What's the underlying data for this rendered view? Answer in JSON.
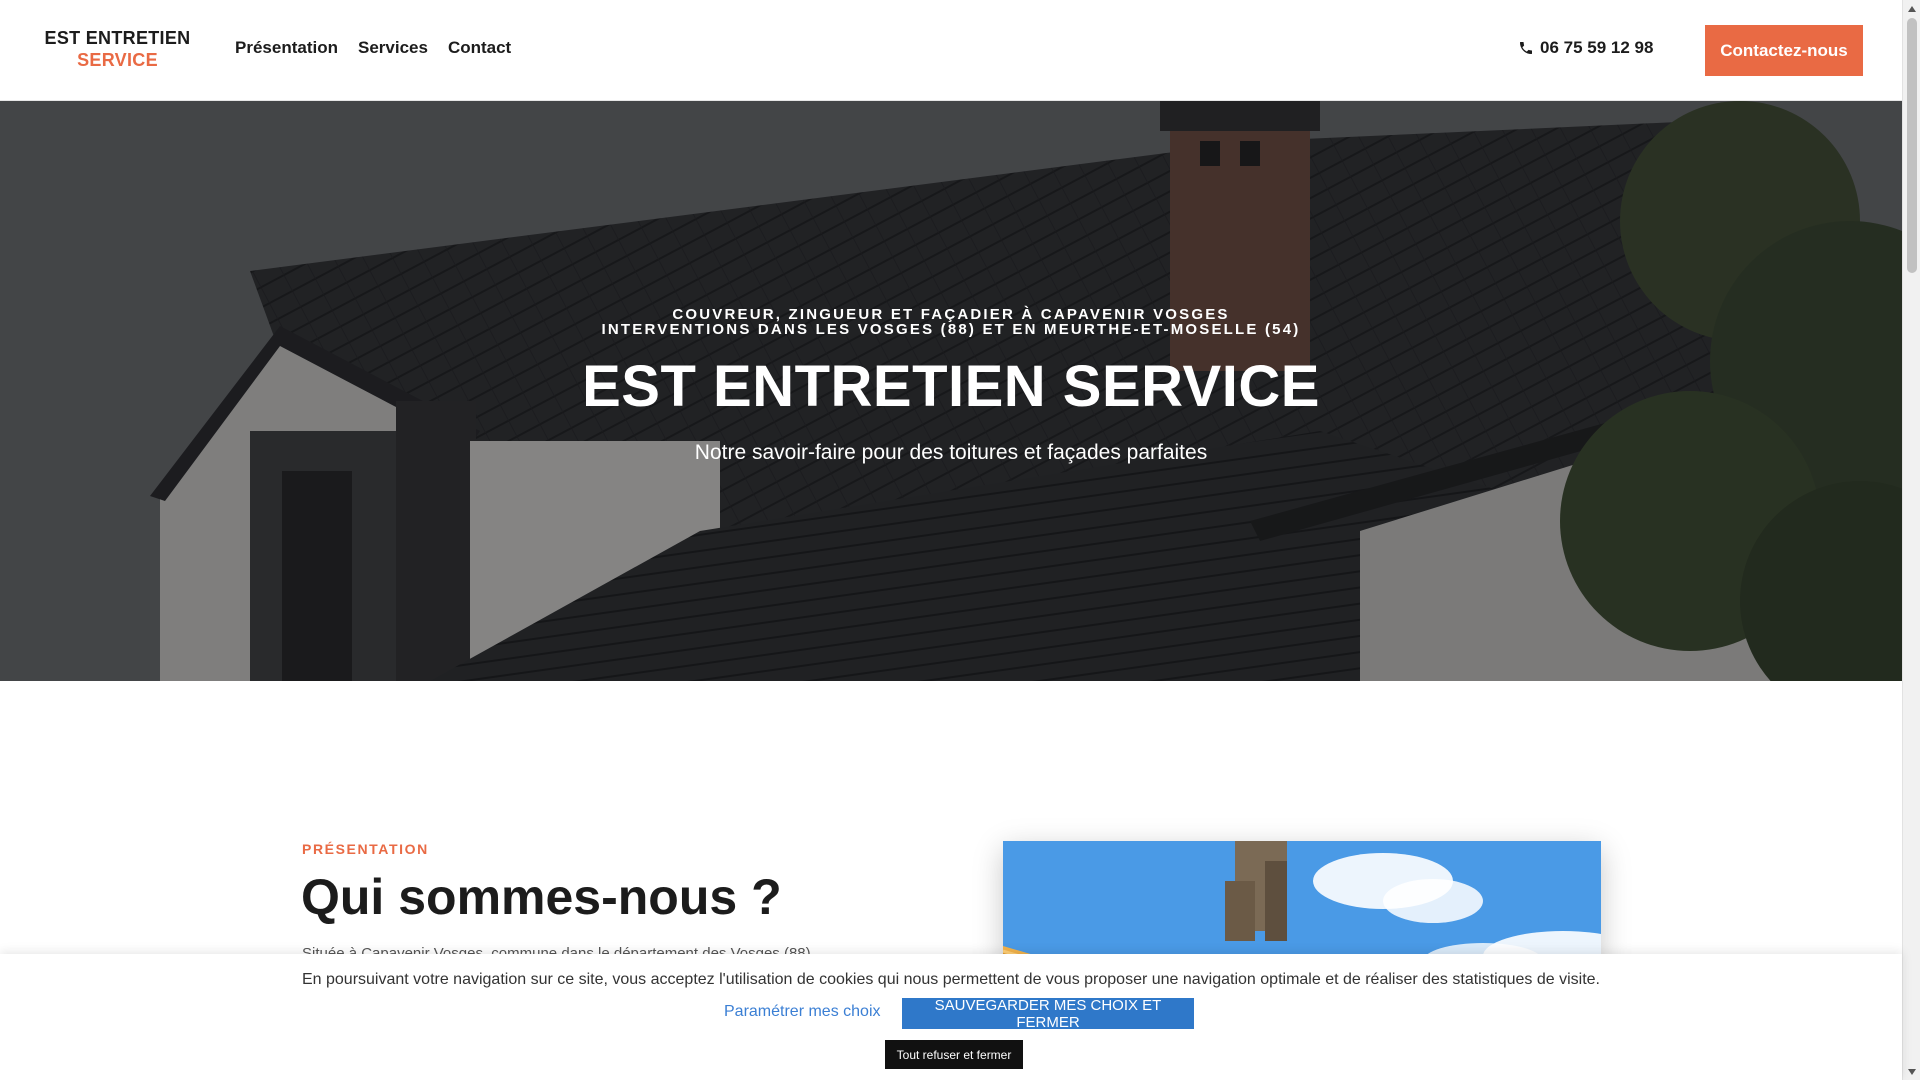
{
  "header": {
    "logo_line1": "EST ENTRETIEN",
    "logo_line2": "SERVICE",
    "nav": [
      "Présentation",
      "Services",
      "Contact"
    ],
    "phone": "06 75 59 12 98",
    "cta_label": "Contactez-nous"
  },
  "hero": {
    "kicker_line1": "COUVREUR, ZINGUEUR ET FAÇADIER À CAPAVENIR VOSGES",
    "kicker_line2": "INTERVENTIONS DANS LES VOSGES (88) ET EN MEURTHE-ET-MOSELLE (54)",
    "title": "EST ENTRETIEN SERVICE",
    "subtitle": "Notre savoir-faire pour des toitures et façades parfaites"
  },
  "presentation": {
    "label": "PRÉSENTATION",
    "title": "Qui sommes-nous ?",
    "text_partial": "Située à Capavenir Vosges, commune dans le département des Vosges (88)"
  },
  "cookie_banner": {
    "text": "En poursuivant votre navigation sur ce site, vous acceptez l'utilisation de cookies qui nous permettent de vous proposer une navigation optimale et de réaliser des statistiques de visite.",
    "settings_label": "Paramétrer mes choix",
    "save_label": "SAUVEGARDER MES CHOIX ET FERMER",
    "refuse_label": "Tout refuser et fermer"
  },
  "colors": {
    "accent": "#e96a44",
    "cookie_button": "#2f78c9",
    "refuse_button": "#111111"
  },
  "icons": [
    "phone-icon",
    "scroll-up-arrow-icon",
    "scroll-down-arrow-icon"
  ]
}
